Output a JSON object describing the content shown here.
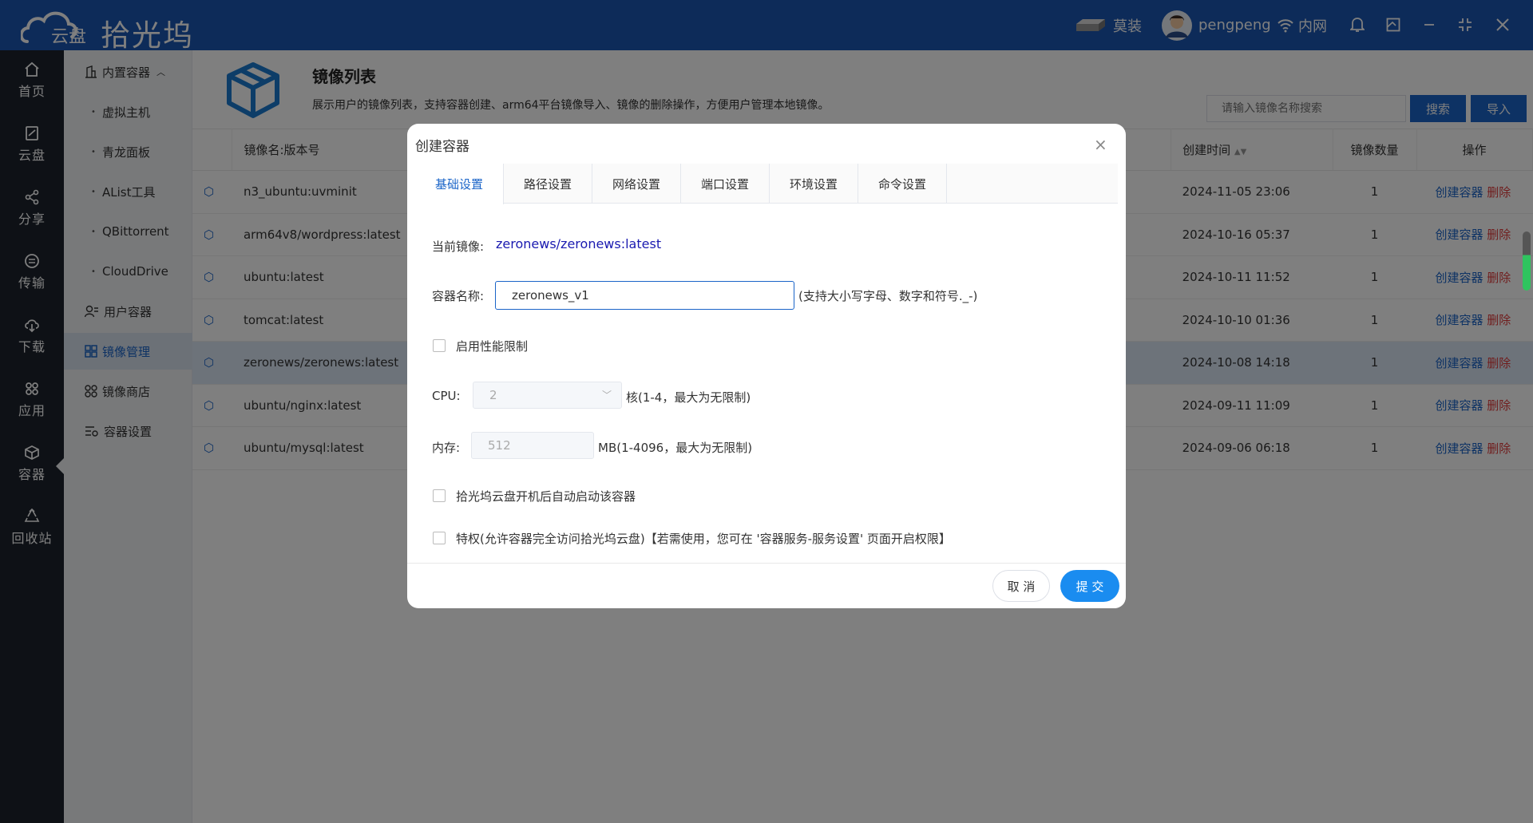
{
  "app": {
    "cloud_text": "云盘",
    "brand": "拾光坞",
    "device": "莫装",
    "user": "pengpeng",
    "network": "内网"
  },
  "nav": [
    {
      "label": "首页",
      "icon": "home-icon"
    },
    {
      "label": "云盘",
      "icon": "cloud-disk-icon"
    },
    {
      "label": "分享",
      "icon": "share-icon"
    },
    {
      "label": "传输",
      "icon": "transfer-icon"
    },
    {
      "label": "下载",
      "icon": "download-icon"
    },
    {
      "label": "应用",
      "icon": "apps-icon"
    },
    {
      "label": "容器",
      "icon": "container-icon"
    },
    {
      "label": "回收站",
      "icon": "recycle-icon"
    }
  ],
  "submenu": {
    "builtin": "内置容器",
    "children": [
      "虚拟主机",
      "青龙面板",
      "AList工具",
      "QBittorrent",
      "CloudDrive"
    ],
    "user_containers": "用户容器",
    "image_manage": "镜像管理",
    "image_store": "镜像商店",
    "container_settings": "容器设置"
  },
  "page": {
    "title": "镜像列表",
    "desc": "展示用户的镜像列表，支持容器创建、arm64平台镜像导入、镜像的删除操作，方便用户管理本地镜像。",
    "search_placeholder": "请输入镜像名称搜索",
    "search_btn": "搜索",
    "import_btn": "导入"
  },
  "table": {
    "headers": {
      "name": "镜像名:版本号",
      "time": "创建时间",
      "count": "镜像数量",
      "ops": "操作"
    },
    "rows": [
      {
        "name": "n3_ubuntu:uvminit",
        "time": "2024-11-05 23:06",
        "count": "1"
      },
      {
        "name": "arm64v8/wordpress:latest",
        "time": "2024-10-16 05:37",
        "count": "1"
      },
      {
        "name": "ubuntu:latest",
        "time": "2024-10-11 11:52",
        "count": "1"
      },
      {
        "name": "tomcat:latest",
        "time": "2024-10-10 01:36",
        "count": "1"
      },
      {
        "name": "zeronews/zeronews:latest",
        "time": "2024-10-08 14:18",
        "count": "1"
      },
      {
        "name": "ubuntu/nginx:latest",
        "time": "2024-09-11 11:09",
        "count": "1"
      },
      {
        "name": "ubuntu/mysql:latest",
        "time": "2024-09-06 06:18",
        "count": "1"
      }
    ],
    "op_create": "创建容器",
    "op_delete": "删除"
  },
  "dialog": {
    "title": "创建容器",
    "tabs": [
      "基础设置",
      "路径设置",
      "网络设置",
      "端口设置",
      "环境设置",
      "命令设置"
    ],
    "current_image_label": "当前镜像:",
    "current_image": "zeronews/zeronews:latest",
    "name_label": "容器名称:",
    "name_value": "zeronews_v1",
    "name_hint": "(支持大小写字母、数字和符号._-)",
    "perf_limit": "启用性能限制",
    "cpu_label": "CPU:",
    "cpu_value": "2",
    "cpu_hint": "核(1-4，最大为无限制)",
    "mem_label": "内存:",
    "mem_value": "512",
    "mem_hint": "MB(1-4096，最大为无限制)",
    "autostart": "拾光坞云盘开机后自动启动该容器",
    "privileged": "特权(允许容器完全访问拾光坞云盘)【若需使用，您可在 '容器服务-服务设置' 页面开启权限】",
    "cancel": "取 消",
    "submit": "提 交"
  }
}
